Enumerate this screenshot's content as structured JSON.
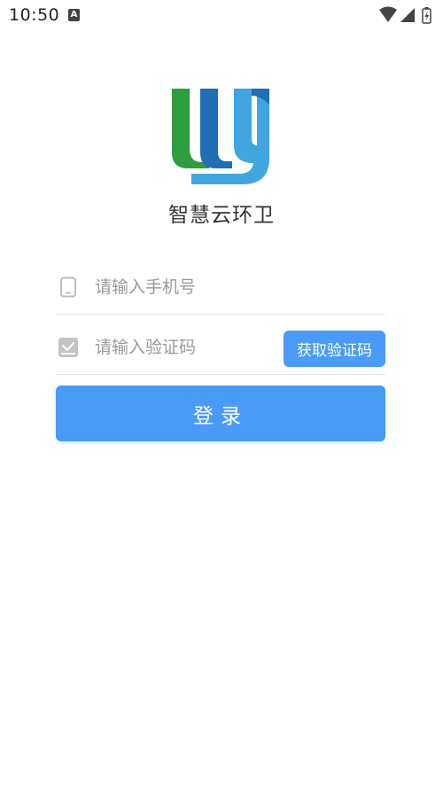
{
  "status_bar": {
    "time": "10:50",
    "notification_icon": "a-icon",
    "icons": [
      "wifi-icon",
      "signal-icon",
      "battery-charging-icon"
    ]
  },
  "app": {
    "logo": "ly-logo",
    "name": "智慧云环卫"
  },
  "form": {
    "phone": {
      "icon": "phone-icon",
      "placeholder": "请输入手机号",
      "value": ""
    },
    "code": {
      "icon": "verify-check-icon",
      "placeholder": "请输入验证码",
      "value": "",
      "get_code_label": "获取验证码"
    },
    "login_label": "登录"
  },
  "colors": {
    "primary": "#4a9bf7",
    "logo_green": "#2e9e3e",
    "logo_blue_dark": "#1f6fb5",
    "logo_blue_light": "#3fa6e0",
    "placeholder": "#9a9a9a",
    "divider": "#e6e6e6"
  }
}
